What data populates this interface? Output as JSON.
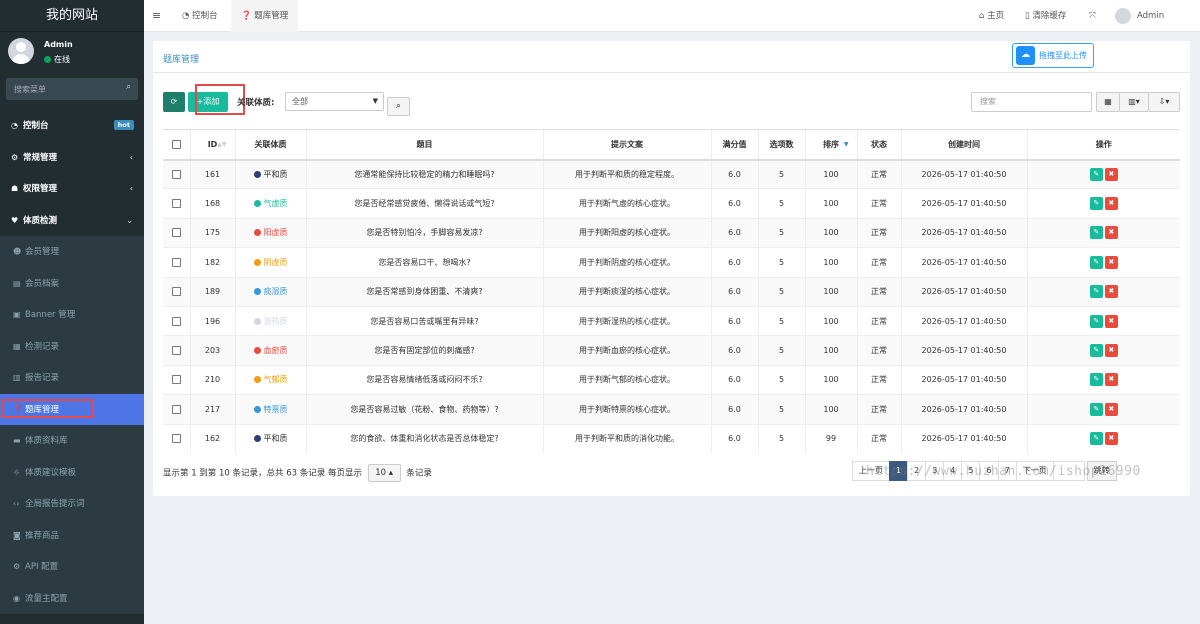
{
  "app": {
    "site_title": "我的网站"
  },
  "user": {
    "name": "Admin",
    "status": "在线"
  },
  "sidebar": {
    "search_placeholder": "搜索菜单",
    "items": [
      {
        "label": "控制台",
        "icon": "dashboard-icon",
        "glyph": "◔",
        "badge": "hot",
        "level": "top"
      },
      {
        "label": "常规管理",
        "icon": "cogs-icon",
        "glyph": "⚙",
        "level": "top",
        "arrow": "‹"
      },
      {
        "label": "权限管理",
        "icon": "group-icon",
        "glyph": "☗",
        "level": "top",
        "arrow": "‹"
      },
      {
        "label": "体质检测",
        "icon": "heartbeat-icon",
        "glyph": "♥",
        "level": "top",
        "arrow": "⌄",
        "expanded": true
      },
      {
        "label": "会员管理",
        "icon": "users-icon",
        "glyph": "☻",
        "level": "sub"
      },
      {
        "label": "会员档案",
        "icon": "id-card-icon",
        "glyph": "▤",
        "level": "sub"
      },
      {
        "label": "Banner 管理",
        "icon": "image-icon",
        "glyph": "▣",
        "level": "sub"
      },
      {
        "label": "检测记录",
        "icon": "list-icon",
        "glyph": "▦",
        "level": "sub"
      },
      {
        "label": "报告记录",
        "icon": "file-icon",
        "glyph": "▥",
        "level": "sub"
      },
      {
        "label": "题库管理",
        "icon": "question-icon",
        "glyph": "❓",
        "level": "sub",
        "active": true
      },
      {
        "label": "体质资料库",
        "icon": "book-icon",
        "glyph": "▬",
        "level": "sub"
      },
      {
        "label": "体质建议模板",
        "icon": "lightbulb-icon",
        "glyph": "☼",
        "level": "sub"
      },
      {
        "label": "全局报告提示词",
        "icon": "code-icon",
        "glyph": "‹›",
        "level": "sub"
      },
      {
        "label": "推荐商品",
        "icon": "shopping-bag-icon",
        "glyph": "◙",
        "level": "sub"
      },
      {
        "label": "API 配置",
        "icon": "gear-icon",
        "glyph": "⚙",
        "level": "sub"
      },
      {
        "label": "流量主配置",
        "icon": "ad-icon",
        "glyph": "◉",
        "level": "sub"
      }
    ]
  },
  "navbar": {
    "toggle_glyph": "≡",
    "tabs": [
      {
        "label": "控制台",
        "glyph": "◔"
      },
      {
        "label": "题库管理",
        "glyph": "❓",
        "active": true
      }
    ],
    "home_label": "主页",
    "clear_cache_label": "清除缓存",
    "admin_label": "Admin"
  },
  "panel": {
    "title": "题库管理",
    "upload_label": "拖拽至此上传",
    "add_label": "添加",
    "filter_label": "关联体质:",
    "filter_value": "全部",
    "table_search_placeholder": "搜索"
  },
  "table": {
    "headers": {
      "id": "ID",
      "constitution": "关联体质",
      "question": "题目",
      "hint": "提示文案",
      "max_score": "满分值",
      "option_count": "选项数",
      "sort": "排序",
      "status": "状态",
      "created": "创建时间",
      "actions": "操作"
    },
    "rows": [
      {
        "id": "161",
        "constitution": "平和质",
        "color": "#2c3e73",
        "question": "您通常能保持比较稳定的精力和睡眠吗?",
        "hint": "用于判断平和质的稳定程度。",
        "max_score": "6.0",
        "option_count": "5",
        "sort": "100",
        "status": "正常",
        "created": "2026-05-17 01:40:50"
      },
      {
        "id": "168",
        "constitution": "气虚质",
        "color": "#18bc9c",
        "question": "您是否经常感觉疲倦、懒得说话或气短?",
        "hint": "用于判断气虚的核心症状。",
        "max_score": "6.0",
        "option_count": "5",
        "sort": "100",
        "status": "正常",
        "created": "2026-05-17 01:40:50"
      },
      {
        "id": "175",
        "constitution": "阳虚质",
        "color": "#e74c3c",
        "question": "您是否特别怕冷，手脚容易发凉?",
        "hint": "用于判断阳虚的核心症状。",
        "max_score": "6.0",
        "option_count": "5",
        "sort": "100",
        "status": "正常",
        "created": "2026-05-17 01:40:50"
      },
      {
        "id": "182",
        "constitution": "阴虚质",
        "color": "#f39c12",
        "question": "您是否容易口干、想喝水?",
        "hint": "用于判断阴虚的核心症状。",
        "max_score": "6.0",
        "option_count": "5",
        "sort": "100",
        "status": "正常",
        "created": "2026-05-17 01:40:50"
      },
      {
        "id": "189",
        "constitution": "痰湿质",
        "color": "#3498db",
        "question": "您是否常感到身体困重、不清爽?",
        "hint": "用于判断痰湿的核心症状。",
        "max_score": "6.0",
        "option_count": "5",
        "sort": "100",
        "status": "正常",
        "created": "2026-05-17 01:40:50"
      },
      {
        "id": "196",
        "constitution": "湿热质",
        "color": "#d2d6de",
        "question": "您是否容易口苦或嘴里有异味?",
        "hint": "用于判断湿热的核心症状。",
        "max_score": "6.0",
        "option_count": "5",
        "sort": "100",
        "status": "正常",
        "created": "2026-05-17 01:40:50"
      },
      {
        "id": "203",
        "constitution": "血瘀质",
        "color": "#e74c3c",
        "question": "您是否有固定部位的刺痛感?",
        "hint": "用于判断血瘀的核心症状。",
        "max_score": "6.0",
        "option_count": "5",
        "sort": "100",
        "status": "正常",
        "created": "2026-05-17 01:40:50"
      },
      {
        "id": "210",
        "constitution": "气郁质",
        "color": "#f39c12",
        "question": "您是否容易情绪低落或闷闷不乐?",
        "hint": "用于判断气郁的核心症状。",
        "max_score": "6.0",
        "option_count": "5",
        "sort": "100",
        "status": "正常",
        "created": "2026-05-17 01:40:50"
      },
      {
        "id": "217",
        "constitution": "特禀质",
        "color": "#3498db",
        "question": "您是否容易过敏（花粉、食物、药物等）?",
        "hint": "用于判断特禀的核心症状。",
        "max_score": "6.0",
        "option_count": "5",
        "sort": "100",
        "status": "正常",
        "created": "2026-05-17 01:40:50"
      },
      {
        "id": "162",
        "constitution": "平和质",
        "color": "#2c3e73",
        "question": "您的食欲、体重和消化状态是否总体稳定?",
        "hint": "用于判断平和质的消化功能。",
        "max_score": "6.0",
        "option_count": "5",
        "sort": "99",
        "status": "正常",
        "created": "2026-05-17 01:40:50"
      }
    ]
  },
  "footer": {
    "info_prefix": "显示第 1 到第 10 条记录，总共 63 条记录 每页显示",
    "page_size": "10",
    "info_suffix": "条记录",
    "pager": [
      "上一页",
      "1",
      "2",
      "3",
      "4",
      "5",
      "6",
      "7",
      "下一页"
    ],
    "active_page": "1",
    "jump_label": "跳转"
  },
  "watermark": "https://www.huzhan.com/ishop26990",
  "colors": {
    "sidebar_bg": "#222d32",
    "active_menu": "#4e75e6",
    "accent": "#18bc9c",
    "link": "#3c8dbc",
    "danger": "#e74c3c"
  }
}
